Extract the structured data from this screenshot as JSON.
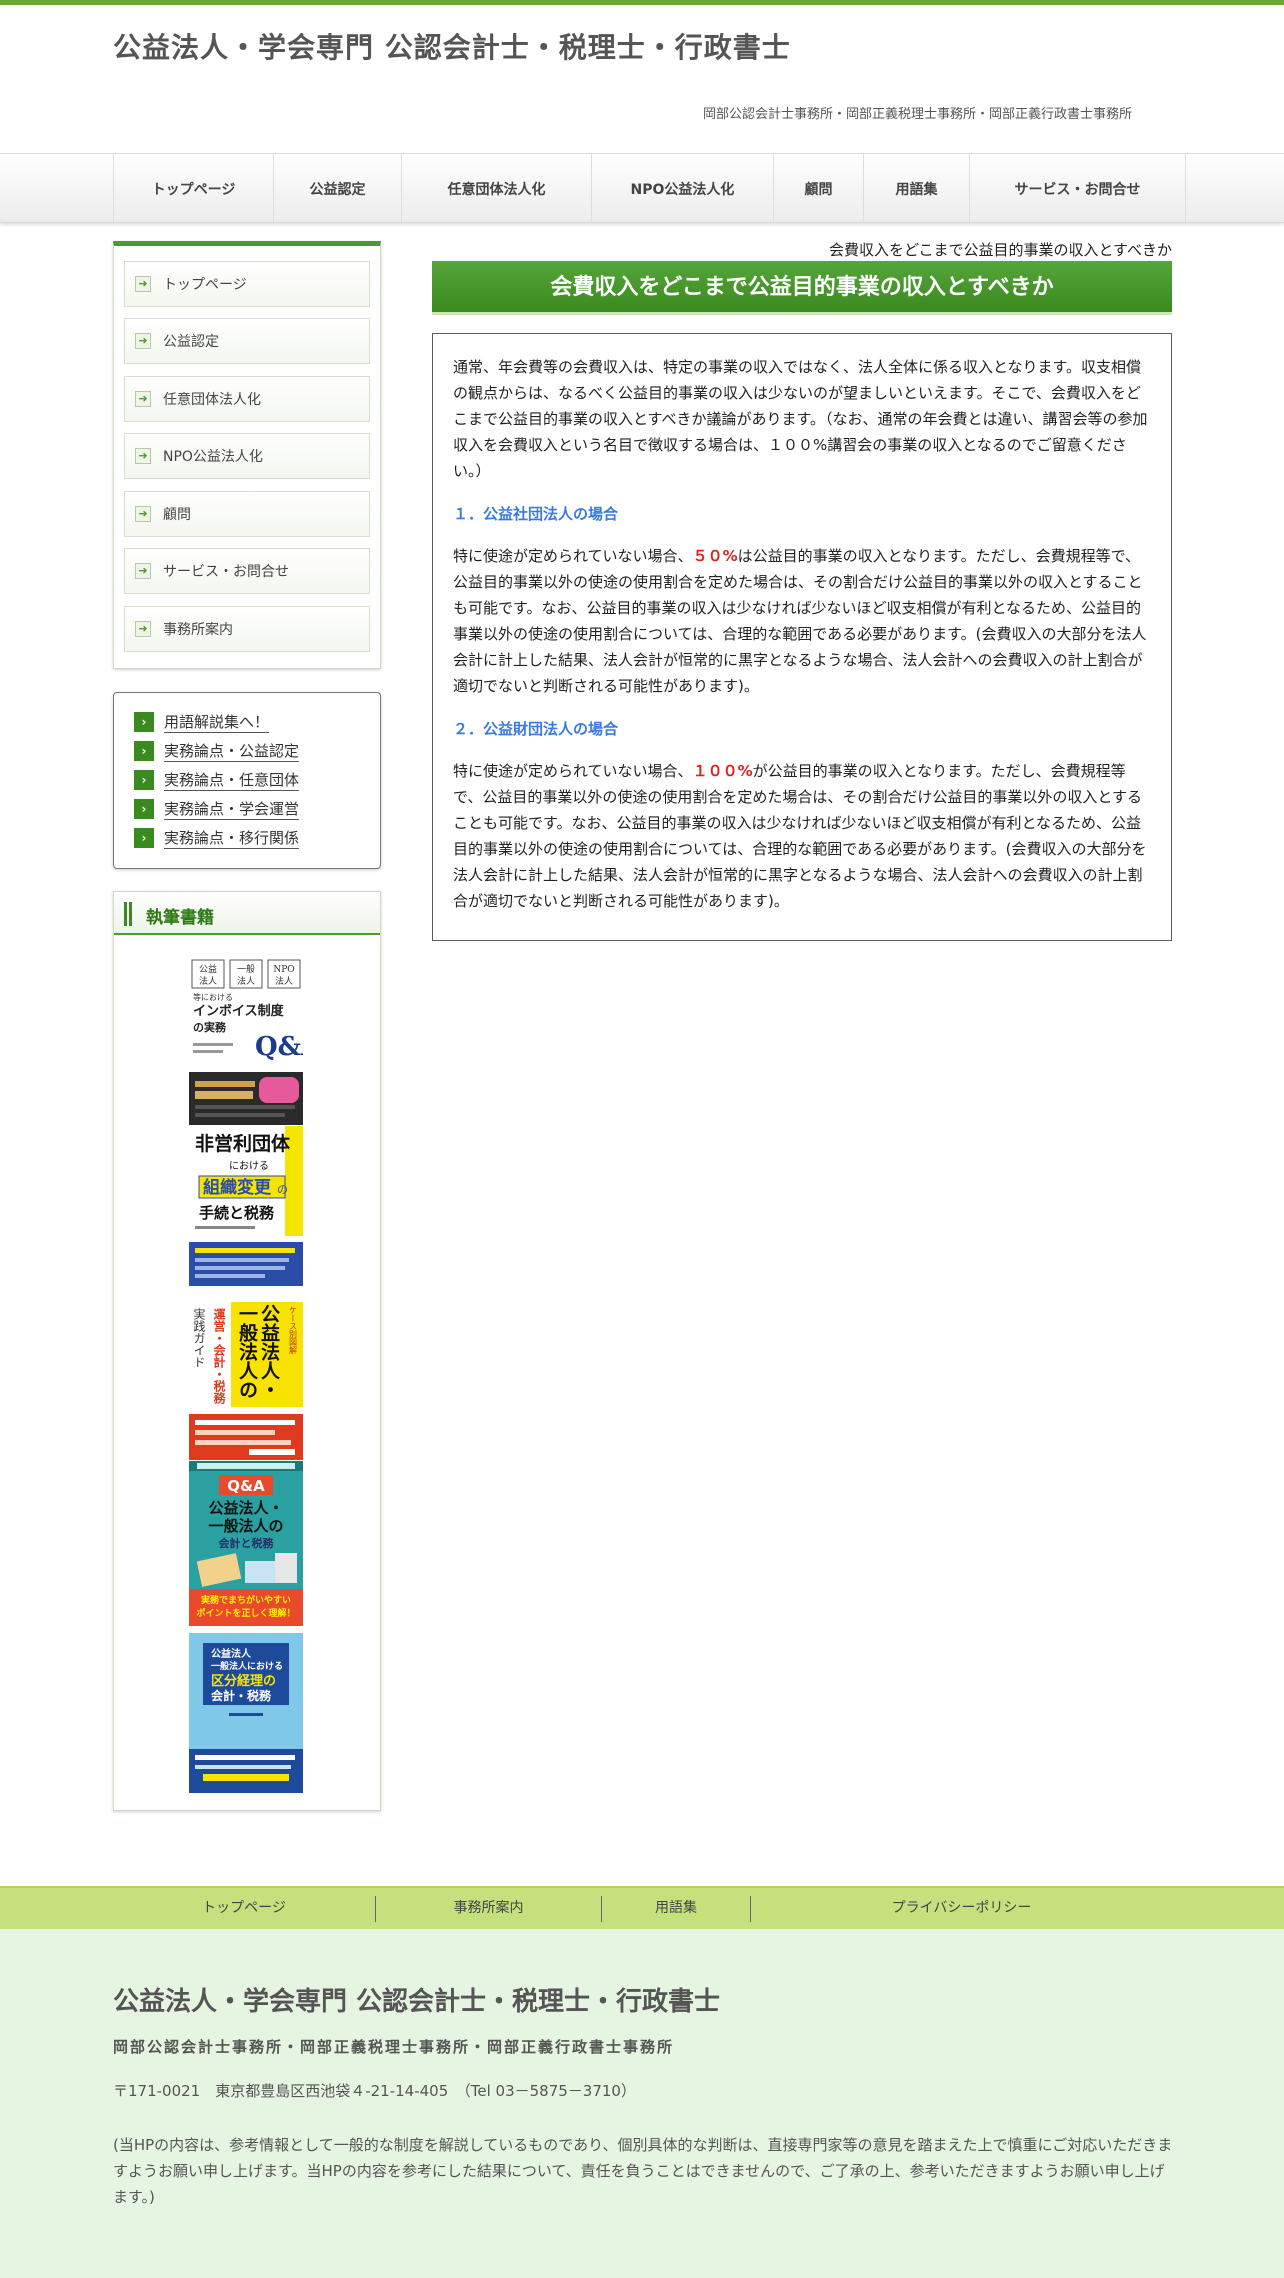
{
  "header": {
    "title": "公益法人・学会専門 公認会計士・税理士・行政書士",
    "subtitle": "岡部公認会計士事務所・岡部正義税理士事務所・岡部正義行政書士事務所"
  },
  "gnav": [
    "トップページ",
    "公益認定",
    "任意団体法人化",
    "NPO公益法人化",
    "顧問",
    "用語集",
    "サービス・お問合せ"
  ],
  "side_menu": [
    "トップページ",
    "公益認定",
    "任意団体法人化",
    "NPO公益法人化",
    "顧問",
    "サービス・お問合せ",
    "事務所案内"
  ],
  "side_links": [
    "用語解説集へ！",
    "実務論点・公益認定",
    "実務論点・任意団体",
    "実務論点・学会運営",
    "実務論点・移行関係"
  ],
  "books": {
    "heading": "執筆書籍",
    "items": [
      {
        "lines": [
          "公益法人",
          "一般法人",
          "NPO法人",
          "等における",
          "インボイス制度",
          "の実務",
          "Q&A"
        ],
        "colors": [
          "#ffffff",
          "#2a2a2a",
          "#1d3b8c"
        ]
      },
      {
        "lines": [
          "非営利団体",
          "における",
          "組織変更の",
          "手続と税務"
        ],
        "colors": [
          "#ffffff",
          "#111111",
          "#f5e500",
          "#2a4da8"
        ]
      },
      {
        "lines": [
          "ケース別 図解",
          "公益法人・",
          "一般法人の",
          "運営・会計・税務",
          "実践ガイド"
        ],
        "colors": [
          "#ffffff",
          "#f7e200",
          "#e03a1e"
        ]
      },
      {
        "lines": [
          "Q&A",
          "公益法人・",
          "一般法人の",
          "会計と税務",
          "実務でまちがいやすい",
          "ポイントを正しく理解！"
        ],
        "colors": [
          "#2aa0a0",
          "#e94a2b",
          "#1f2f6b"
        ]
      },
      {
        "lines": [
          "公益法人",
          "一般法人における",
          "区分経理の",
          "会計・税務"
        ],
        "colors": [
          "#7fc8e8",
          "#1e4a9c",
          "#f5e500"
        ]
      }
    ]
  },
  "main": {
    "breadcrumb": "会費収入をどこまで公益目的事業の収入とすべきか",
    "title": "会費収入をどこまで公益目的事業の収入とすべきか",
    "intro": "通常、年会費等の会費収入は、特定の事業の収入ではなく、法人全体に係る収入となります。収支相償の観点からは、なるべく公益目的事業の収入は少ないのが望ましいといえます。そこで、会費収入をどこまで公益目的事業の収入とすべきか議論があります。（なお、通常の年会費とは違い、講習会等の参加収入を会費収入という名目で徴収する場合は、１００%講習会の事業の収入となるのでご留意ください。）",
    "sec1_heading": "１．公益社団法人の場合",
    "sec1_pre": "特に使途が定められていない場合、",
    "sec1_pct": "５０%",
    "sec1_post": "は公益目的事業の収入となります。ただし、会費規程等で、公益目的事業以外の使途の使用割合を定めた場合は、その割合だけ公益目的事業以外の収入とすることも可能です。なお、公益目的事業の収入は少なければ少ないほど収支相償が有利となるため、公益目的事業以外の使途の使用割合については、合理的な範囲である必要があります。(会費収入の大部分を法人会計に計上した結果、法人会計が恒常的に黒字となるような場合、法人会計への会費収入の計上割合が適切でないと判断される可能性があります)。",
    "sec2_heading": "２．公益財団法人の場合",
    "sec2_pre": "特に使途が定められていない場合、",
    "sec2_pct": "１００%",
    "sec2_post": "が公益目的事業の収入となります。ただし、会費規程等で、公益目的事業以外の使途の使用割合を定めた場合は、その割合だけ公益目的事業以外の収入とすることも可能です。なお、公益目的事業の収入は少なければ少ないほど収支相償が有利となるため、公益目的事業以外の使途の使用割合については、合理的な範囲である必要があります。(会費収入の大部分を法人会計に計上した結果、法人会計が恒常的に黒字となるような場合、法人会計への会費収入の計上割合が適切でないと判断される可能性があります)。"
  },
  "footer_nav": [
    "トップページ",
    "事務所案内",
    "用語集",
    "プライバシーポリシー"
  ],
  "footer": {
    "title": "公益法人・学会専門 公認会計士・税理士・行政書士",
    "sub": "岡部公認会計士事務所・岡部正義税理士事務所・岡部正義行政書士事務所",
    "address": "〒171-0021　東京都豊島区西池袋４-21-14-405　（Tel 03－5875－3710）",
    "note": "(当HPの内容は、参考情報として一般的な制度を解説しているものであり、個別具体的な判断は、直接専門家等の意見を踏まえた上で慎重にご対応いただきますようお願い申し上げます。当HPの内容を参考にした結果について、責任を負うことはできませんので、ご了承の上、参考いただきますようお願い申し上げます。)"
  },
  "colors": {
    "accent": "#4e9a2e",
    "title_bar": "#3a8a20",
    "highlight": "#e02020",
    "heading_blue": "#3a7ae0",
    "footer_nav_bg": "#c5e07c",
    "footer_bg": "#e6f4e2"
  }
}
